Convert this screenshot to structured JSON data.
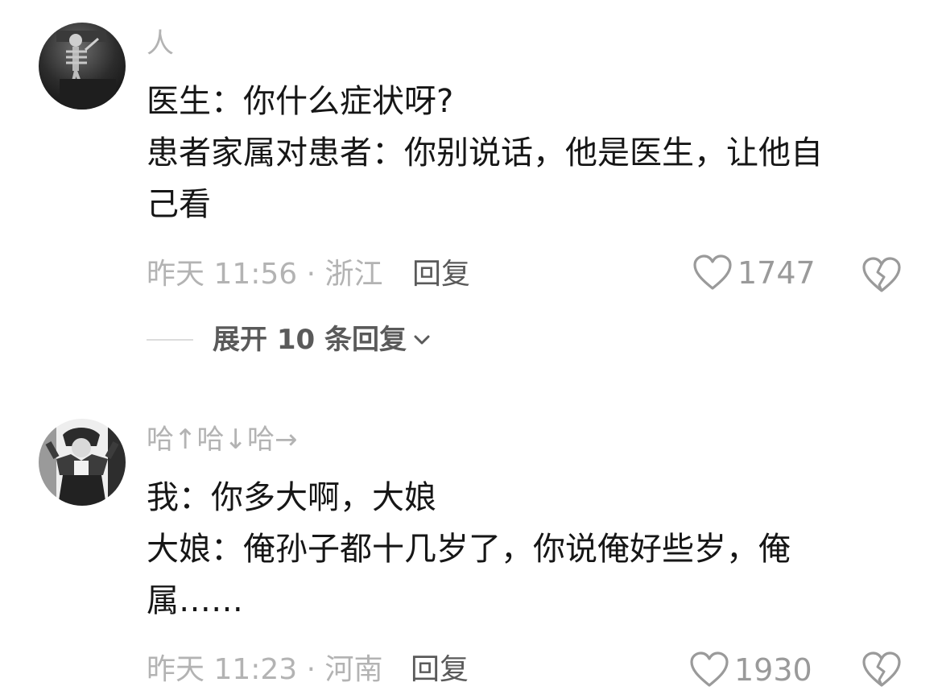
{
  "comments": [
    {
      "username": "人",
      "lines": [
        "医生：你什么症状呀?",
        "患者家属对患者：你别说话，他是医生，让他自",
        "己看"
      ],
      "time_location": "昨天 11:56 · 浙江",
      "reply_label": "回复",
      "like_count": "1747",
      "expand_label": "展开 10 条回复"
    },
    {
      "username": "哈↑哈↓哈→",
      "lines": [
        "我：你多大啊，大娘",
        "大娘：俺孙子都十几岁了，你说俺好些岁，俺",
        "属……"
      ],
      "time_location": "昨天 11:23 · 河南",
      "reply_label": "回复",
      "like_count": "1930"
    }
  ]
}
